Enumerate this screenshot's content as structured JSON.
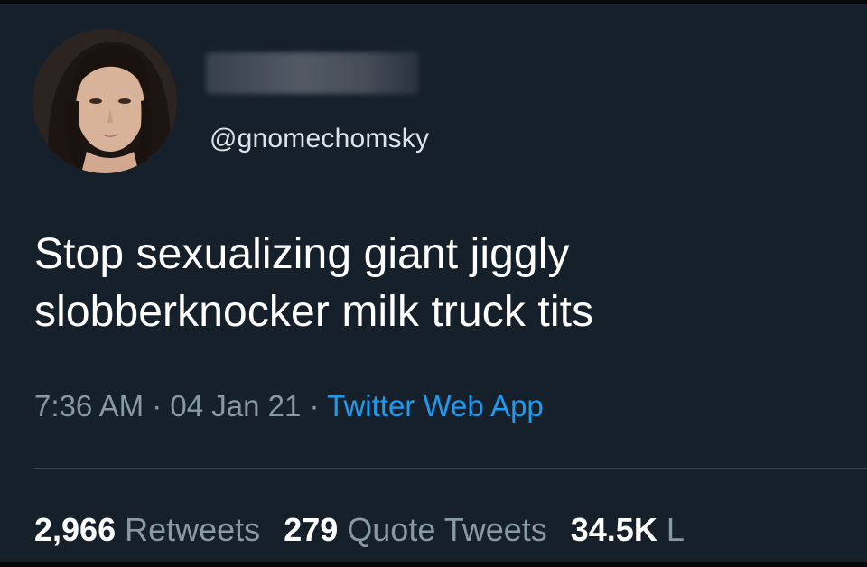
{
  "tweet": {
    "handle": "@gnomechomsky",
    "text": "Stop sexualizing giant jiggly slobberknocker milk truck tits",
    "time": "7:36 AM",
    "date": "04 Jan 21",
    "separator": " · ",
    "source": "Twitter Web App"
  },
  "stats": {
    "retweets_count": "2,966",
    "retweets_label": "Retweets",
    "quotes_count": "279",
    "quotes_label": "Quote Tweets",
    "likes_count": "34.5K",
    "likes_label": "L"
  },
  "colors": {
    "background": "#15202b",
    "text": "#ffffff",
    "muted": "#8899a6",
    "link": "#1d9bf0"
  },
  "icons": {
    "avatar": "profile-photo"
  }
}
